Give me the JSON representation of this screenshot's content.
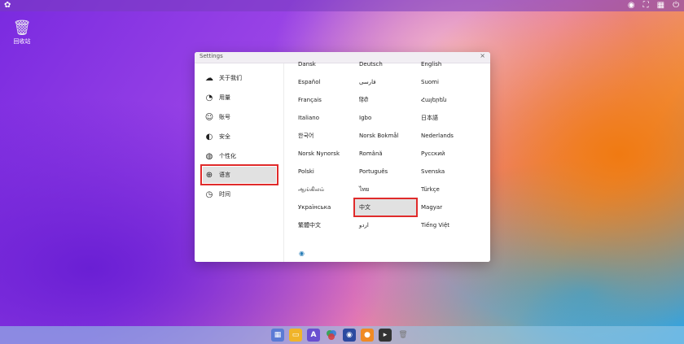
{
  "desktop": {
    "trash_label": "回收站"
  },
  "window": {
    "title": "Settings",
    "close_glyph": "×"
  },
  "sidebar": {
    "items": [
      {
        "label": "关于我们",
        "icon": "about-icon"
      },
      {
        "label": "用量",
        "icon": "gauge-icon"
      },
      {
        "label": "账号",
        "icon": "user-icon"
      },
      {
        "label": "安全",
        "icon": "shield-icon"
      },
      {
        "label": "个性化",
        "icon": "palette-icon"
      },
      {
        "label": "语言",
        "icon": "globe-icon",
        "active": true
      },
      {
        "label": "时间",
        "icon": "clock-icon"
      }
    ]
  },
  "languages": [
    [
      "Dansk",
      "Deutsch",
      "English"
    ],
    [
      "Español",
      "فارسی",
      "Suomi"
    ],
    [
      "Français",
      "हिंदी",
      "Հայերեն"
    ],
    [
      "Italiano",
      "Igbo",
      "日本語"
    ],
    [
      "한국어",
      "Norsk Bokmål",
      "Nederlands"
    ],
    [
      "Norsk Nynorsk",
      "Română",
      "Русский"
    ],
    [
      "Polski",
      "Português",
      "Svenska"
    ],
    [
      "ஆங்கிலம்",
      "ไทย",
      "Türkçe"
    ],
    [
      "Українська",
      "中文",
      "Magyar"
    ],
    [
      "繁體中文",
      "اردو",
      "Tiếng Việt"
    ]
  ],
  "selected_language": "中文",
  "colors": {
    "highlight_border": "#e02b2b",
    "selected_bg": "#e1e1e1"
  },
  "dock": {
    "items": [
      {
        "name": "launcher-icon",
        "color": "#5b7bd5"
      },
      {
        "name": "files-icon",
        "color": "#f0b429"
      },
      {
        "name": "text-editor-icon",
        "color": "#6a4fd0"
      },
      {
        "name": "app-store-icon",
        "color": "#3aa35a"
      },
      {
        "name": "browser-icon",
        "color": "#2c4aa0"
      },
      {
        "name": "recorder-icon",
        "color": "#f08a24"
      },
      {
        "name": "terminal-icon",
        "color": "#333333"
      },
      {
        "name": "trash-icon",
        "color": "#8a8a8a"
      }
    ]
  }
}
